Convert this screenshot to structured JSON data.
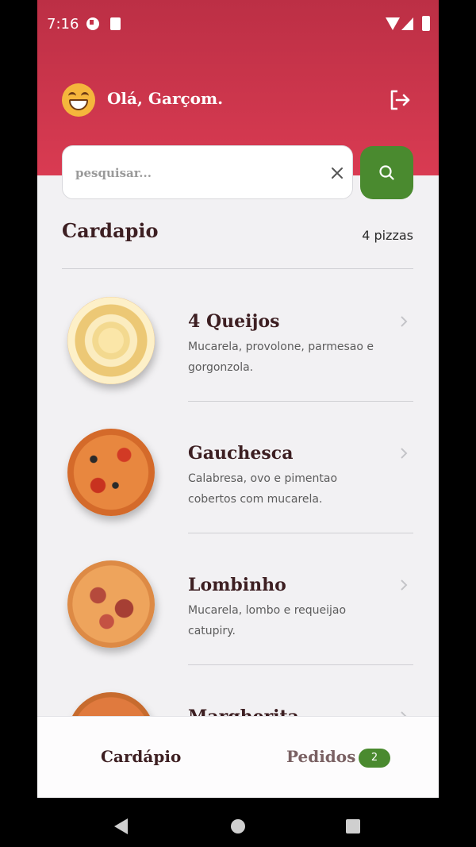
{
  "status_bar": {
    "time": "7:16"
  },
  "header": {
    "greeting": "Olá, Garçom.",
    "avatar_icon": "grinning-face-emoji",
    "logout_icon": "logout-icon"
  },
  "search": {
    "placeholder": "pesquisar...",
    "value": ""
  },
  "menu": {
    "title": "Cardapio",
    "count": "4 pizzas",
    "items": [
      {
        "name": "4 Queijos",
        "description": "Mucarela, provolone, parmesao e gorgonzola."
      },
      {
        "name": "Gauchesca",
        "description": "Calabresa, ovo e pimentao cobertos com mucarela."
      },
      {
        "name": "Lombinho",
        "description": "Mucarela, lombo e requeijao catupiry."
      },
      {
        "name": "Margherita",
        "description": ""
      }
    ]
  },
  "tabs": {
    "cardapio": "Cardápio",
    "pedidos": "Pedidos",
    "pedidos_badge": "2"
  },
  "colors": {
    "brand_red": "#c9344b",
    "accent_green": "#4a8a2f",
    "text_dark": "#3d1f22"
  }
}
